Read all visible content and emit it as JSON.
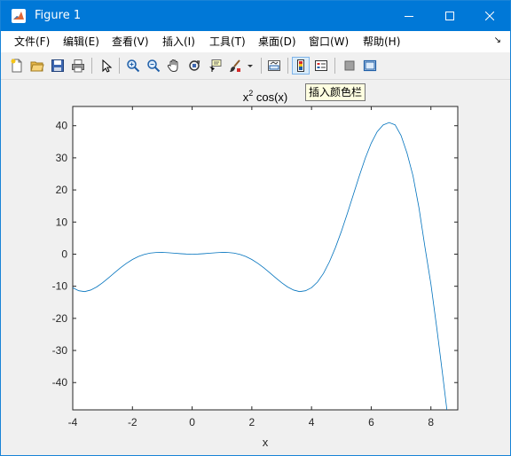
{
  "window": {
    "title": "Figure 1"
  },
  "menubar": {
    "items": [
      {
        "label": "文件(F)"
      },
      {
        "label": "编辑(E)"
      },
      {
        "label": "查看(V)"
      },
      {
        "label": "插入(I)"
      },
      {
        "label": "工具(T)"
      },
      {
        "label": "桌面(D)"
      },
      {
        "label": "窗口(W)"
      },
      {
        "label": "帮助(H)"
      }
    ]
  },
  "toolbar": {
    "tooltip": "插入颜色栏",
    "icons": [
      "new-figure-icon",
      "open-file-icon",
      "save-icon",
      "print-icon",
      "pointer-icon",
      "zoom-in-icon",
      "zoom-out-icon",
      "pan-icon",
      "rotate-3d-icon",
      "data-cursor-icon",
      "brush-icon",
      "link-plot-icon",
      "insert-colorbar-icon",
      "insert-legend-icon",
      "hide-plot-tools-icon",
      "show-plot-tools-icon"
    ]
  },
  "chart_data": {
    "type": "line",
    "title": "x",
    "title_superscript": "2",
    "title_suffix": " cos(x)",
    "xlabel": "x",
    "ylabel": "",
    "xlim": [
      -4,
      8.9
    ],
    "ylim": [
      -48.5,
      46
    ],
    "xticks": [
      -4,
      -2,
      0,
      2,
      4,
      6,
      8
    ],
    "yticks": [
      40,
      30,
      20,
      10,
      0,
      -10,
      -20,
      -30,
      -40
    ],
    "function": "x^2*cos(x)",
    "series": [
      {
        "color": "#0072bd",
        "x": [
          -4,
          -3.8,
          -3.6,
          -3.4,
          -3.2,
          -3,
          -2.8,
          -2.6,
          -2.4,
          -2.2,
          -2,
          -1.8,
          -1.6,
          -1.4,
          -1.2,
          -1,
          -0.8,
          -0.6,
          -0.4,
          -0.2,
          0,
          0.2,
          0.4,
          0.6,
          0.8,
          1,
          1.2,
          1.4,
          1.6,
          1.8,
          2,
          2.2,
          2.4,
          2.6,
          2.8,
          3,
          3.2,
          3.4,
          3.6,
          3.8,
          4,
          4.2,
          4.4,
          4.6,
          4.8,
          5,
          5.2,
          5.4,
          5.6,
          5.8,
          6,
          6.2,
          6.4,
          6.6,
          6.8,
          7,
          7.2,
          7.4,
          7.6,
          7.8,
          8,
          8.2,
          8.4,
          8.6
        ],
        "y": [
          -10.46,
          -11.39,
          -11.66,
          -11.18,
          -10.23,
          -8.91,
          -7.38,
          -5.8,
          -4.25,
          -2.85,
          -1.66,
          -0.74,
          -0.07,
          0.33,
          0.52,
          0.54,
          0.45,
          0.3,
          0.15,
          0.04,
          0,
          0.04,
          0.15,
          0.3,
          0.45,
          0.54,
          0.52,
          0.33,
          -0.07,
          -0.74,
          -1.66,
          -2.85,
          -4.25,
          -5.8,
          -7.38,
          -8.91,
          -10.23,
          -11.18,
          -11.66,
          -11.39,
          -10.46,
          -8.68,
          -6.01,
          -2.39,
          2.02,
          7.09,
          12.66,
          18.5,
          24.35,
          29.86,
          34.56,
          38.13,
          40.24,
          40.99,
          40.27,
          36.94,
          31.46,
          24.4,
          14.43,
          2.23,
          -9.31,
          -23.22,
          -38.09,
          -53.44
        ]
      }
    ]
  }
}
